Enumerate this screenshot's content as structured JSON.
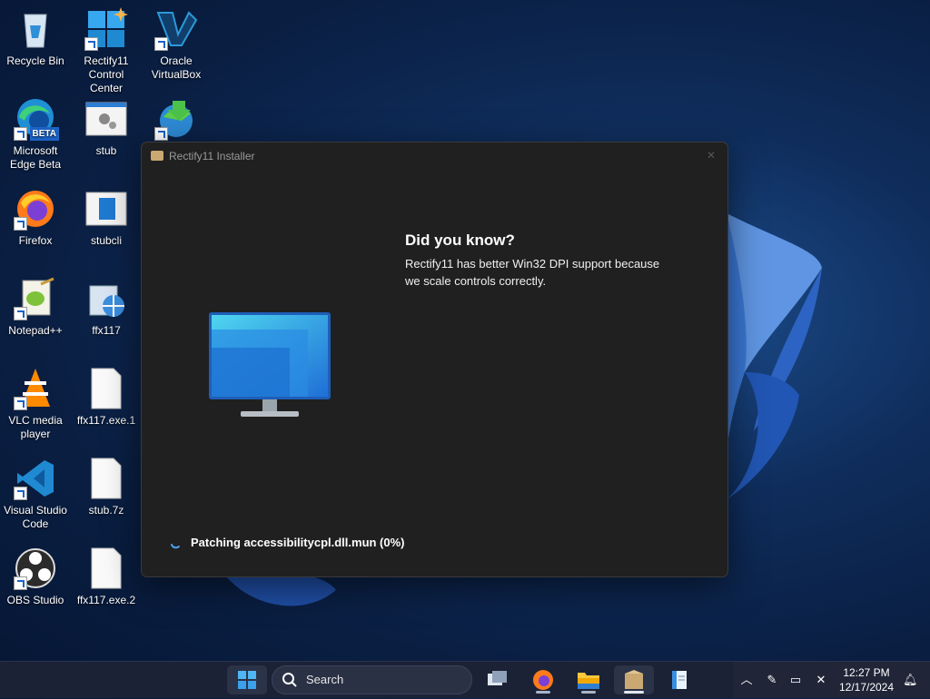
{
  "desktop": {
    "icons": [
      {
        "label": "Recycle Bin"
      },
      {
        "label": "Rectify11 Control Center"
      },
      {
        "label": "Oracle VirtualBox"
      },
      {
        "label": "Microsoft Edge Beta",
        "badge": "BETA"
      },
      {
        "label": "stub"
      },
      {
        "label": "Firefox"
      },
      {
        "label": "stubcli"
      },
      {
        "label": "Notepad++"
      },
      {
        "label": "ffx117"
      },
      {
        "label": "VLC media player"
      },
      {
        "label": "ffx117.exe.1"
      },
      {
        "label": "Visual Studio Code"
      },
      {
        "label": "stub.7z"
      },
      {
        "label": "OBS Studio"
      },
      {
        "label": "ffx117.exe.2"
      }
    ]
  },
  "installer": {
    "title": "Rectify11 Installer",
    "tip_title": "Did you know?",
    "tip_body": "Rectify11 has better Win32 DPI support because we scale controls correctly.",
    "status": "Patching accessibilitycpl.dll.mun (0%)",
    "progress_percent": 0
  },
  "taskbar": {
    "search_placeholder": "Search",
    "time": "12:27 PM",
    "date": "12/17/2024",
    "pinned": [
      "task-view",
      "firefox",
      "file-explorer",
      "installer",
      "notepad"
    ]
  },
  "colors": {
    "accent": "#1c63c7",
    "window_bg": "#202020",
    "taskbar_bg": "#1b2235"
  }
}
